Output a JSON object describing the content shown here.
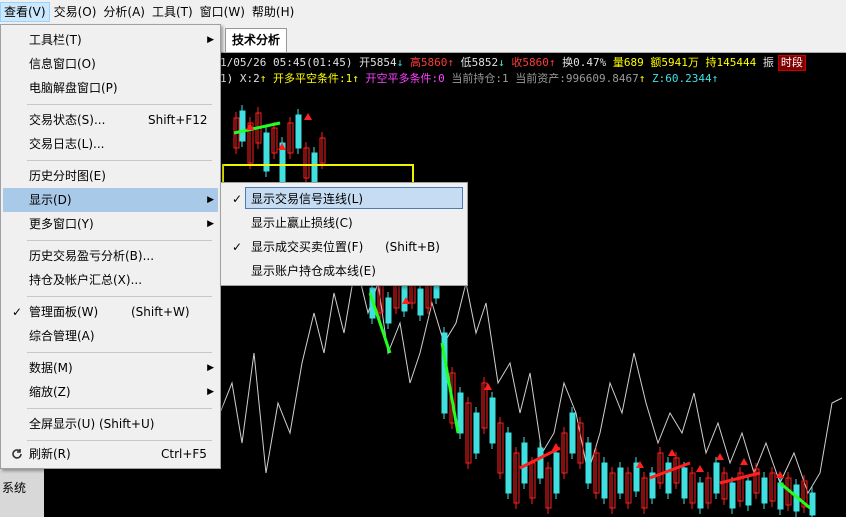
{
  "menubar": {
    "items": [
      "查看(V)",
      "交易(O)",
      "分析(A)",
      "工具(T)",
      "窗口(W)",
      "帮助(H)"
    ]
  },
  "tabs": {
    "active": "技术分析"
  },
  "left_pane": {
    "text": "系统"
  },
  "infobar": {
    "date_time": "1/05/26 05:45(01:45)",
    "open": "开5854",
    "open_dir": "↓",
    "high": "高5860",
    "high_dir": "↑",
    "low": "低5852",
    "low_dir": "↓",
    "close": "收5860",
    "close_dir": "↑",
    "turnover": "换0.47%",
    "volume": "量689",
    "amount": "额5941万",
    "holding": "持145444",
    "cut": "振",
    "period_badge": "时段"
  },
  "infobar2": {
    "prefix": "1) X:2",
    "prefix_dir": "↑",
    "cond1": "开多平空条件:1",
    "cond1_dir": "↑",
    "cond2": "开空平多条件:0",
    "position": "当前持仓:1",
    "assets": "当前资产:996609.8467",
    "assets_dir": "↑",
    "z": "Z:60.2344",
    "z_dir": "↑"
  },
  "view_menu": {
    "items": [
      {
        "label": "工具栏(T)",
        "arrow": "▶"
      },
      {
        "label": "信息窗口(O)"
      },
      {
        "label": "电脑解盘窗口(P)"
      },
      {
        "label": "交易状态(S)...",
        "shortcut": "Shift+F12"
      },
      {
        "label": "交易日志(L)..."
      },
      {
        "label": "历史分时图(E)"
      },
      {
        "label": "显示(D)",
        "arrow": "▶"
      },
      {
        "label": "更多窗口(Y)",
        "arrow": "▶"
      },
      {
        "label": "历史交易盈亏分析(B)..."
      },
      {
        "label": "持仓及帐户汇总(X)..."
      },
      {
        "label": "管理面板(W)",
        "shortcut": "(Shift+W)",
        "check": "✓"
      },
      {
        "label": "综合管理(A)"
      },
      {
        "label": "数据(M)",
        "arrow": "▶"
      },
      {
        "label": "缩放(Z)",
        "arrow": "▶"
      },
      {
        "label": "全屏显示(U) (Shift+U)"
      },
      {
        "label": "刷新(R)",
        "shortcut": "Ctrl+F5",
        "icon": "refresh-icon"
      }
    ]
  },
  "display_submenu": {
    "items": [
      {
        "label": "显示交易信号连线(L)",
        "check": "✓"
      },
      {
        "label": "显示止赢止损线(C)"
      },
      {
        "label": "显示成交买卖位置(F)",
        "shortcut": "(Shift+B)",
        "check": "✓"
      },
      {
        "label": "显示账户持仓成本线(E)"
      }
    ]
  },
  "colors": {
    "up_candle": "#ff2020",
    "down_candle": "#40e0e0",
    "buy_line": "#ff2020",
    "sell_line": "#20ff20",
    "indicator_line": "#cfcfcf",
    "annotation_box": "#f2f200"
  }
}
